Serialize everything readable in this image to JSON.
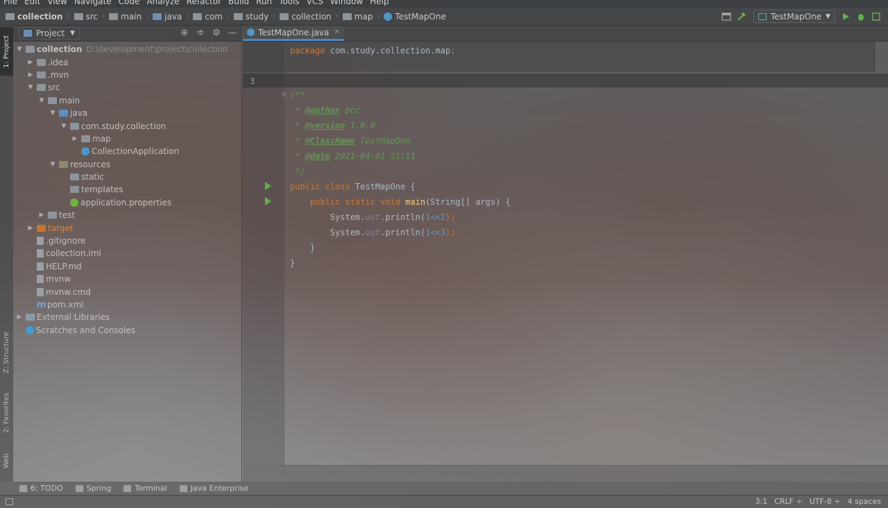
{
  "menu": [
    "File",
    "Edit",
    "View",
    "Navigate",
    "Code",
    "Analyze",
    "Refactor",
    "Build",
    "Run",
    "Tools",
    "VCS",
    "Window",
    "Help"
  ],
  "breadcrumbs": [
    "collection",
    "src",
    "main",
    "java",
    "com",
    "study",
    "collection",
    "map",
    "TestMapOne"
  ],
  "run_config": "TestMapOne",
  "left_stripe": {
    "project": "1: Project",
    "structure": "Z: Structure",
    "favorites": "2: Favorites",
    "web": "Web"
  },
  "project_panel": {
    "title": "Project",
    "tree": [
      {
        "label": "collection",
        "path": "D:\\development\\project\\collection",
        "depth": 0,
        "arrow": "▼",
        "icon": "folder"
      },
      {
        "label": ".idea",
        "depth": 1,
        "arrow": "▶",
        "icon": "folder"
      },
      {
        "label": ".mvn",
        "depth": 1,
        "arrow": "▶",
        "icon": "folder"
      },
      {
        "label": "src",
        "depth": 1,
        "arrow": "▼",
        "icon": "folder"
      },
      {
        "label": "main",
        "depth": 2,
        "arrow": "▼",
        "icon": "folder"
      },
      {
        "label": "java",
        "depth": 3,
        "arrow": "▼",
        "icon": "blue"
      },
      {
        "label": "com.study.collection",
        "depth": 4,
        "arrow": "▼",
        "icon": "folder"
      },
      {
        "label": "map",
        "depth": 5,
        "arrow": "▶",
        "icon": "folder"
      },
      {
        "label": "CollectionApplication",
        "depth": 5,
        "arrow": "",
        "icon": "class"
      },
      {
        "label": "resources",
        "depth": 3,
        "arrow": "▼",
        "icon": "res"
      },
      {
        "label": "static",
        "depth": 4,
        "arrow": "",
        "icon": "folder"
      },
      {
        "label": "templates",
        "depth": 4,
        "arrow": "",
        "icon": "folder"
      },
      {
        "label": "application.properties",
        "depth": 4,
        "arrow": "",
        "icon": "spring"
      },
      {
        "label": "test",
        "depth": 2,
        "arrow": "▶",
        "icon": "folder"
      },
      {
        "label": "target",
        "depth": 1,
        "arrow": "▶",
        "icon": "orange"
      },
      {
        "label": ".gitignore",
        "depth": 1,
        "arrow": "",
        "icon": "file"
      },
      {
        "label": "collection.iml",
        "depth": 1,
        "arrow": "",
        "icon": "file"
      },
      {
        "label": "HELP.md",
        "depth": 1,
        "arrow": "",
        "icon": "file"
      },
      {
        "label": "mvnw",
        "depth": 1,
        "arrow": "",
        "icon": "file"
      },
      {
        "label": "mvnw.cmd",
        "depth": 1,
        "arrow": "",
        "icon": "file"
      },
      {
        "label": "pom.xml",
        "depth": 1,
        "arrow": "",
        "icon": "maven"
      },
      {
        "label": "External Libraries",
        "depth": 0,
        "arrow": "▶",
        "icon": "lib"
      },
      {
        "label": "Scratches and Consoles",
        "depth": 0,
        "arrow": "",
        "icon": "scratch"
      }
    ]
  },
  "editor": {
    "tab": "TestMapOne.java",
    "line_number": "3",
    "code": {
      "l1_kw": "package",
      "l1_pkg": " com.study.collection.map",
      "l1_semi": ";",
      "c_open": "/**",
      "author_tag": "@author",
      "author_val": " pcc",
      "version_tag": "@version",
      "version_val": " 1.0.0",
      "classname_tag": "@ClassName",
      "classname_val": " TestMapOne",
      "date_tag": "@date",
      "date_val": " 2021-04-01 21:11",
      "c_close": " */",
      "class_kw": "public class",
      "class_name": " TestMapOne ",
      "brace_open": "{",
      "method_kw": "public static void",
      "method_name": " main",
      "method_params": "(String[] args) ",
      "print1_obj": "System.",
      "print1_field": "out",
      "print1_call": ".println(",
      "print1_arg": "1<<2",
      "print1_end": ");",
      "print2_obj": "System.",
      "print2_field": "out",
      "print2_call": ".println(",
      "print2_arg": "1<<3",
      "print2_end": ");",
      "brace_close_inner": "}",
      "brace_close_outer": "}"
    }
  },
  "bottom_tools": [
    "6: TODO",
    "Spring",
    "Terminal",
    "Java Enterprise"
  ],
  "status": {
    "position": "3:1",
    "line_sep": "CRLF ÷",
    "encoding": "UTF-8 ÷",
    "indent": "4 spaces"
  }
}
